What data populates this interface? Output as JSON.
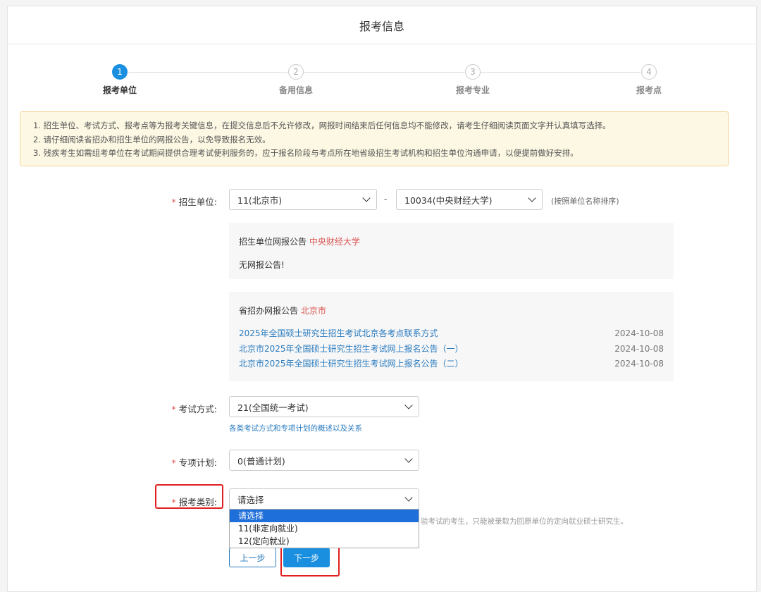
{
  "header": {
    "title": "报考信息"
  },
  "steps": [
    {
      "num": "1",
      "label": "报考单位",
      "state": "active"
    },
    {
      "num": "2",
      "label": "备用信息",
      "state": "inactive"
    },
    {
      "num": "3",
      "label": "报考专业",
      "state": "inactive"
    },
    {
      "num": "4",
      "label": "报考点",
      "state": "inactive"
    }
  ],
  "notice": {
    "lines": [
      "1. 招生单位、考试方式、报考点等为报考关键信息，在提交信息后不允许修改，网报时间结束后任何信息均不能修改，请考生仔细阅读页面文字并认真填写选择。",
      "2. 请仔细阅读省招办和招生单位的网报公告，以免导致报名无效。",
      "3. 残疾考生如需组考单位在考试期间提供合理考试便利服务的，应于报名阶段与考点所在地省级招生考试机构和招生单位沟通申请，以便提前做好安排。"
    ]
  },
  "form": {
    "required_mark": "*",
    "unit": {
      "label": "招生单位:",
      "province_value": "11(北京市)",
      "separator": "-",
      "school_value": "10034(中央财经大学)",
      "hint": "(按照单位名称排序)"
    },
    "unit_announcement": {
      "title": "招生单位网报公告",
      "title_highlight": "中央财经大学",
      "body": "无网报公告!"
    },
    "province_announcement": {
      "title": "省招办网报公告",
      "title_highlight": "北京市",
      "items": [
        {
          "text": "2025年全国硕士研究生招生考试北京各考点联系方式",
          "date": "2024-10-08"
        },
        {
          "text": "北京市2025年全国硕士研究生招生考试网上报名公告（一）",
          "date": "2024-10-08"
        },
        {
          "text": "北京市2025年全国硕士研究生招生考试网上报名公告（二）",
          "date": "2024-10-08"
        }
      ]
    },
    "exam_mode": {
      "label": "考试方式:",
      "value": "21(全国统一考试)",
      "link": "各类考试方式和专项计划的概述以及关系"
    },
    "special_plan": {
      "label": "专项计划:",
      "value": "0(普通计划)"
    },
    "category": {
      "label": "报考类别:",
      "value": "请选择",
      "options": [
        "请选择",
        "11(非定向就业)",
        "12(定向就业)"
      ],
      "selected_index": 0,
      "hint_partial": "验考试的考生，只能被录取为回原单位的定向就业硕士研究生。"
    }
  },
  "buttons": {
    "prev": "上一步",
    "next": "下一步"
  },
  "colors": {
    "primary": "#1a8fe0",
    "link": "#2a7bbf",
    "required": "#d9534f",
    "annotation": "#e02020",
    "notice_bg": "#fcf8e3"
  }
}
